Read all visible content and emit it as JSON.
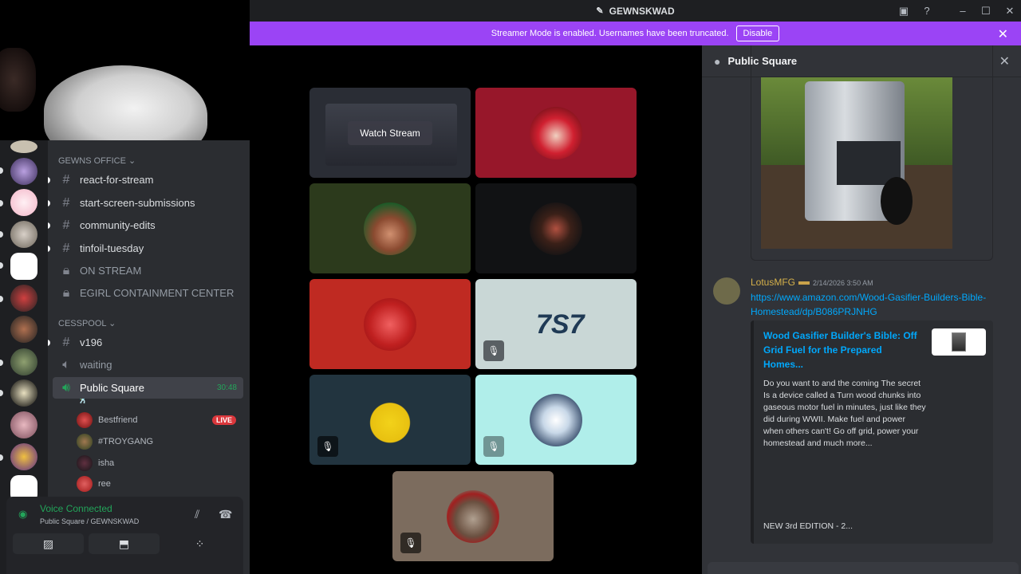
{
  "window": {
    "title": "GEWNSKWAD"
  },
  "banner": {
    "text": "Streamer Mode is enabled. Usernames have been truncated.",
    "button": "Disable"
  },
  "channels": {
    "category1": "GEWNS OFFICE",
    "items1": [
      "react-for-stream",
      "start-screen-submissions",
      "community-edits",
      "tinfoil-tuesday",
      "ON STREAM",
      "EGIRL CONTAINMENT CENTER"
    ],
    "category2": "CESSPOOL",
    "v196": "v196",
    "v196_emoji": "🕺",
    "waiting": "waiting",
    "public_square": "Public Square",
    "timer": "30:48",
    "voice_users": [
      "Bestfriend",
      "#TROYGANG",
      "isha",
      "ree"
    ],
    "live_badge": "LIVE"
  },
  "voice_panel": {
    "status": "Voice Connected",
    "sub": "Public Square / GEWNSKWAD"
  },
  "stage": {
    "watch": "Watch Stream"
  },
  "panel": {
    "title": "Public Square",
    "author": "LotusMFG",
    "timestamp": "2/14/2026 3:50 AM",
    "link": "https://www.amazon.com/Wood-Gasifier-Builders-Bible-Homestead/dp/B086PRJNHG",
    "embed_title": "Wood Gasifier Builder's Bible: Off Grid Fuel for the Prepared Homes...",
    "embed_desc": "Do you want to and the coming The secret Is a device called a Turn wood chunks into gaseous motor fuel in minutes, just like they did during WWII. Make fuel and power when others can't! Go off grid, power your homestead and much more...",
    "embed_footer": "NEW 3rd EDITION - 2..."
  },
  "colors": {
    "accent": "#9b44f5",
    "online": "#23a55a",
    "link": "#00a8fc",
    "live": "#da373c"
  }
}
